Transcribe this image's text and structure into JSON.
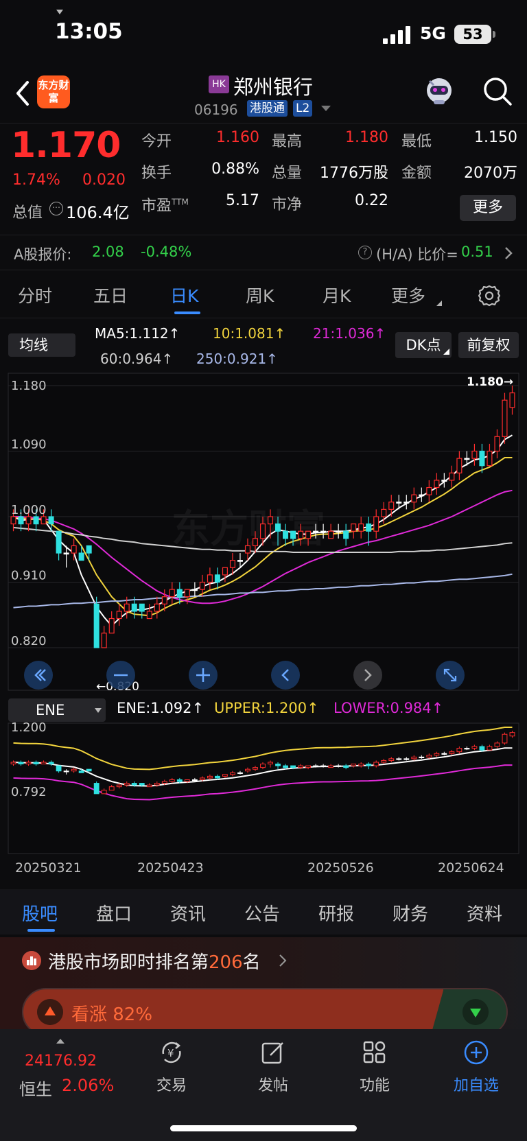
{
  "status_bar": {
    "time": "13:05",
    "network": "5G",
    "battery": "53"
  },
  "header": {
    "brand_logo": "东方财富",
    "market_badge": "HK",
    "stock_name": "郑州银行",
    "stock_code": "06196",
    "connect_badge": "港股通",
    "level_badge": "L2"
  },
  "quote": {
    "last_price": "1.170",
    "change_pct": "1.74%",
    "change_amt": "0.020",
    "market_cap_label": "总值",
    "market_cap_value": "106.4亿",
    "fields": [
      {
        "label": "今开",
        "value": "1.160",
        "color": "#ff2d2d"
      },
      {
        "label": "最高",
        "value": "1.180",
        "color": "#ff2d2d"
      },
      {
        "label": "最低",
        "value": "1.150",
        "color": "#ffffff"
      },
      {
        "label": "换手",
        "value": "0.88%",
        "color": "#ffffff"
      },
      {
        "label": "总量",
        "value": "1776万股",
        "color": "#ffffff"
      },
      {
        "label": "金额",
        "value": "2070万",
        "color": "#ffffff"
      },
      {
        "label": "市盈",
        "value": "5.17",
        "color": "#ffffff"
      },
      {
        "label": "市净",
        "value": "0.22",
        "color": "#ffffff"
      }
    ],
    "pe_suffix": "TTM",
    "more_button": "更多"
  },
  "ashare": {
    "label": "A股报价:",
    "price": "2.08",
    "change": "-0.48%",
    "ratio_label": "(H/A) 比价=",
    "ratio_value": "0.51"
  },
  "period_tabs": [
    "分时",
    "五日",
    "日K",
    "周K",
    "月K",
    "更多"
  ],
  "active_period": 2,
  "indicators": {
    "ma_selector": "均线",
    "ma_labels": [
      {
        "text": "MA5:1.112↑",
        "color": "#ffffff"
      },
      {
        "text": "10:1.081↑",
        "color": "#f2d43d"
      },
      {
        "text": "21:1.036↑",
        "color": "#e02ad8"
      },
      {
        "text": "60:0.964↑",
        "color": "#d0d0d0"
      },
      {
        "text": "250:0.921↑",
        "color": "#a8b8e8"
      }
    ],
    "dk_button": "DK点",
    "adjust_button": "前复权",
    "ene_selector": "ENE",
    "ene_labels": [
      {
        "text": "ENE:1.092↑",
        "color": "#ffffff"
      },
      {
        "text": "UPPER:1.200↑",
        "color": "#f2d43d"
      },
      {
        "text": "LOWER:0.984↑",
        "color": "#e02ad8"
      }
    ]
  },
  "chart_data": {
    "type": "candlestick",
    "y_ticks": [
      "1.180",
      "1.090",
      "1.000",
      "0.910",
      "0.820"
    ],
    "ylim": [
      0.82,
      1.18
    ],
    "low_marker": "←0.820",
    "high_marker": "1.180→",
    "ene_y_ticks": [
      "1.200",
      "0.792"
    ],
    "ene_ylim": [
      0.792,
      1.2
    ],
    "x_labels": [
      "20250321",
      "20250423",
      "20250526",
      "20250624"
    ],
    "candles": [
      [
        0.99,
        1.0,
        1.01,
        0.98
      ],
      [
        1.0,
        0.99,
        1.01,
        0.98
      ],
      [
        0.99,
        1.0,
        1.01,
        0.98
      ],
      [
        1.0,
        0.99,
        1.01,
        0.98
      ],
      [
        0.99,
        1.0,
        1.01,
        0.99
      ],
      [
        1.0,
        0.99,
        1.01,
        0.98
      ],
      [
        0.98,
        0.95,
        0.98,
        0.94
      ],
      [
        0.95,
        0.95,
        0.96,
        0.93
      ],
      [
        0.95,
        0.96,
        0.97,
        0.94
      ],
      [
        0.95,
        0.94,
        0.96,
        0.94
      ],
      [
        0.96,
        0.95,
        0.96,
        0.94
      ],
      [
        0.88,
        0.82,
        0.89,
        0.82
      ],
      [
        0.82,
        0.84,
        0.85,
        0.82
      ],
      [
        0.84,
        0.86,
        0.87,
        0.84
      ],
      [
        0.86,
        0.87,
        0.88,
        0.85
      ],
      [
        0.87,
        0.88,
        0.89,
        0.86
      ],
      [
        0.88,
        0.87,
        0.89,
        0.86
      ],
      [
        0.88,
        0.87,
        0.88,
        0.86
      ],
      [
        0.86,
        0.87,
        0.88,
        0.86
      ],
      [
        0.87,
        0.88,
        0.89,
        0.86
      ],
      [
        0.88,
        0.89,
        0.9,
        0.87
      ],
      [
        0.89,
        0.9,
        0.91,
        0.88
      ],
      [
        0.9,
        0.89,
        0.91,
        0.88
      ],
      [
        0.89,
        0.9,
        0.9,
        0.88
      ],
      [
        0.9,
        0.9,
        0.91,
        0.89
      ],
      [
        0.9,
        0.91,
        0.92,
        0.89
      ],
      [
        0.91,
        0.92,
        0.93,
        0.9
      ],
      [
        0.92,
        0.91,
        0.93,
        0.9
      ],
      [
        0.92,
        0.93,
        0.93,
        0.91
      ],
      [
        0.93,
        0.94,
        0.95,
        0.92
      ],
      [
        0.94,
        0.94,
        0.95,
        0.93
      ],
      [
        0.95,
        0.96,
        0.97,
        0.94
      ],
      [
        0.96,
        0.97,
        0.98,
        0.95
      ],
      [
        0.97,
        0.99,
        1.0,
        0.96
      ],
      [
        0.99,
        1.0,
        1.01,
        0.97
      ],
      [
        0.99,
        0.98,
        1.0,
        0.96
      ],
      [
        0.98,
        0.97,
        0.99,
        0.96
      ],
      [
        0.98,
        0.97,
        0.98,
        0.96
      ],
      [
        0.97,
        0.98,
        0.99,
        0.96
      ],
      [
        0.97,
        0.98,
        0.98,
        0.96
      ],
      [
        0.98,
        0.98,
        0.99,
        0.97
      ],
      [
        0.98,
        0.98,
        0.99,
        0.97
      ],
      [
        0.97,
        0.98,
        0.99,
        0.97
      ],
      [
        0.98,
        0.98,
        0.99,
        0.97
      ],
      [
        0.98,
        0.97,
        0.99,
        0.96
      ],
      [
        0.98,
        0.99,
        0.99,
        0.97
      ],
      [
        0.98,
        0.99,
        1.0,
        0.97
      ],
      [
        0.99,
        0.98,
        1.0,
        0.96
      ],
      [
        0.98,
        1.0,
        1.01,
        0.97
      ],
      [
        1.0,
        1.01,
        1.02,
        0.99
      ],
      [
        1.01,
        1.02,
        1.03,
        1.0
      ],
      [
        1.02,
        1.02,
        1.03,
        1.01
      ],
      [
        1.02,
        1.02,
        1.03,
        1.01
      ],
      [
        1.02,
        1.03,
        1.04,
        1.01
      ],
      [
        1.03,
        1.03,
        1.04,
        1.02
      ],
      [
        1.03,
        1.04,
        1.05,
        1.02
      ],
      [
        1.04,
        1.05,
        1.06,
        1.03
      ],
      [
        1.05,
        1.05,
        1.06,
        1.04
      ],
      [
        1.05,
        1.06,
        1.07,
        1.04
      ],
      [
        1.06,
        1.08,
        1.09,
        1.05
      ],
      [
        1.08,
        1.08,
        1.09,
        1.07
      ],
      [
        1.08,
        1.09,
        1.1,
        1.07
      ],
      [
        1.09,
        1.07,
        1.1,
        1.06
      ],
      [
        1.07,
        1.09,
        1.1,
        1.07
      ],
      [
        1.09,
        1.11,
        1.12,
        1.08
      ],
      [
        1.11,
        1.16,
        1.17,
        1.1
      ],
      [
        1.15,
        1.17,
        1.18,
        1.14
      ]
    ],
    "series": [
      {
        "name": "MA5",
        "color": "#ffffff",
        "values": [
          1.0,
          0.995,
          0.996,
          0.997,
          0.996,
          0.982,
          0.968,
          0.958,
          0.95,
          0.92,
          0.898,
          0.876,
          0.862,
          0.85,
          0.86,
          0.868,
          0.872,
          0.872,
          0.874,
          0.878,
          0.884,
          0.89,
          0.894,
          0.898,
          0.9,
          0.904,
          0.908,
          0.91,
          0.916,
          0.922,
          0.93,
          0.94,
          0.952,
          0.964,
          0.976,
          0.982,
          0.98,
          0.978,
          0.976,
          0.976,
          0.978,
          0.978,
          0.98,
          0.98,
          0.98,
          0.982,
          0.984,
          0.986,
          0.99,
          0.996,
          1.004,
          1.012,
          1.018,
          1.024,
          1.028,
          1.034,
          1.04,
          1.048,
          1.056,
          1.066,
          1.072,
          1.078,
          1.08,
          1.084,
          1.092,
          1.106,
          1.112
        ]
      },
      {
        "name": "10",
        "color": "#f2d43d",
        "values": [
          1.0,
          0.998,
          0.997,
          0.997,
          0.995,
          0.99,
          0.982,
          0.977,
          0.973,
          0.96,
          0.94,
          0.92,
          0.905,
          0.89,
          0.88,
          0.87,
          0.866,
          0.865,
          0.864,
          0.868,
          0.874,
          0.879,
          0.883,
          0.886,
          0.889,
          0.894,
          0.899,
          0.902,
          0.906,
          0.911,
          0.917,
          0.924,
          0.931,
          0.94,
          0.949,
          0.956,
          0.962,
          0.966,
          0.969,
          0.972,
          0.975,
          0.976,
          0.976,
          0.977,
          0.978,
          0.98,
          0.981,
          0.982,
          0.984,
          0.988,
          0.993,
          0.998,
          1.003,
          1.008,
          1.013,
          1.019,
          1.025,
          1.031,
          1.038,
          1.046,
          1.053,
          1.06,
          1.064,
          1.068,
          1.074,
          1.081,
          1.081
        ]
      },
      {
        "name": "21",
        "color": "#e02ad8",
        "values": [
          1.0,
          1.0,
          0.999,
          0.998,
          0.997,
          0.995,
          0.991,
          0.987,
          0.983,
          0.977,
          0.97,
          0.962,
          0.953,
          0.944,
          0.936,
          0.928,
          0.92,
          0.912,
          0.905,
          0.898,
          0.893,
          0.889,
          0.886,
          0.884,
          0.882,
          0.881,
          0.881,
          0.882,
          0.884,
          0.887,
          0.89,
          0.894,
          0.899,
          0.904,
          0.91,
          0.916,
          0.922,
          0.927,
          0.932,
          0.937,
          0.941,
          0.945,
          0.949,
          0.953,
          0.956,
          0.959,
          0.962,
          0.965,
          0.967,
          0.97,
          0.973,
          0.976,
          0.979,
          0.982,
          0.985,
          0.988,
          0.992,
          0.996,
          1.0,
          1.005,
          1.01,
          1.015,
          1.02,
          1.025,
          1.03,
          1.034,
          1.036
        ]
      },
      {
        "name": "60",
        "color": "#d0d0d0",
        "values": [
          0.985,
          0.984,
          0.983,
          0.982,
          0.981,
          0.98,
          0.979,
          0.978,
          0.976,
          0.975,
          0.973,
          0.972,
          0.97,
          0.969,
          0.967,
          0.966,
          0.965,
          0.963,
          0.962,
          0.961,
          0.96,
          0.959,
          0.958,
          0.957,
          0.956,
          0.955,
          0.955,
          0.954,
          0.954,
          0.953,
          0.953,
          0.953,
          0.952,
          0.952,
          0.952,
          0.952,
          0.952,
          0.951,
          0.951,
          0.951,
          0.951,
          0.951,
          0.951,
          0.951,
          0.951,
          0.951,
          0.951,
          0.951,
          0.951,
          0.951,
          0.951,
          0.952,
          0.952,
          0.952,
          0.953,
          0.953,
          0.954,
          0.954,
          0.955,
          0.956,
          0.957,
          0.958,
          0.959,
          0.96,
          0.961,
          0.963,
          0.964
        ]
      },
      {
        "name": "250",
        "color": "#a8b8e8",
        "values": [
          0.875,
          0.876,
          0.877,
          0.877,
          0.878,
          0.879,
          0.879,
          0.88,
          0.881,
          0.881,
          0.882,
          0.882,
          0.883,
          0.884,
          0.884,
          0.885,
          0.886,
          0.886,
          0.887,
          0.888,
          0.888,
          0.889,
          0.889,
          0.89,
          0.891,
          0.891,
          0.892,
          0.893,
          0.893,
          0.894,
          0.895,
          0.895,
          0.896,
          0.896,
          0.897,
          0.898,
          0.898,
          0.899,
          0.9,
          0.9,
          0.901,
          0.901,
          0.902,
          0.903,
          0.903,
          0.904,
          0.905,
          0.905,
          0.906,
          0.907,
          0.907,
          0.908,
          0.909,
          0.909,
          0.91,
          0.911,
          0.911,
          0.912,
          0.913,
          0.914,
          0.914,
          0.915,
          0.916,
          0.917,
          0.918,
          0.919,
          0.921
        ]
      }
    ],
    "ene_series": [
      {
        "name": "ENE",
        "color": "#ffffff"
      },
      {
        "name": "UPPER",
        "color": "#f2d43d"
      },
      {
        "name": "LOWER",
        "color": "#e02ad8"
      }
    ]
  },
  "content_tabs": [
    "股吧",
    "盘口",
    "资讯",
    "公告",
    "研报",
    "财务",
    "资料"
  ],
  "active_content_tab": 0,
  "ranking": {
    "prefix": "港股市场即时排名第",
    "rank": "206",
    "suffix": "名",
    "bull_label": "看涨 82%",
    "bull_pct": 82
  },
  "bottom_nav": {
    "index_value": "24176.92",
    "index_name": "恒生",
    "index_change": "2.06%",
    "items": [
      "交易",
      "发帖",
      "功能",
      "加自选"
    ]
  },
  "colors": {
    "up": "#ff2d2d",
    "down": "#33d04a",
    "down_candle": "#2fe0e0",
    "accent": "#3a8cff"
  }
}
